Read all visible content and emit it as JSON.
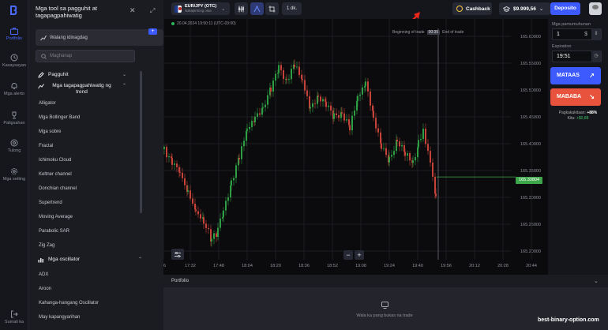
{
  "rail": {
    "items": [
      {
        "label": "Portfolio",
        "icon": "briefcase-icon"
      },
      {
        "label": "Kasaysayan",
        "icon": "history-icon"
      },
      {
        "label": "Mga alerto",
        "icon": "bell-icon"
      },
      {
        "label": "Paligsahan",
        "icon": "trophy-icon"
      },
      {
        "label": "Tulong",
        "icon": "help-icon"
      },
      {
        "label": "Mga setting",
        "icon": "gear-icon"
      },
      {
        "label": "Sumali ka",
        "icon": "logout-icon"
      }
    ]
  },
  "panel": {
    "title": "Mga tool sa pagguhit at tagapagpahiwatig",
    "default_label": "Walang idinagdag",
    "add_badge": "+",
    "search_placeholder": "Maghanap",
    "section_drawing": "Pagguhit",
    "section_indicators": "Mga tagapagpahiwatig ng trend",
    "trend_items": [
      "Alligator",
      "Mga Bollinger Band",
      "Mga sobre",
      "Fractal",
      "Ichimoku Cloud",
      "Keltner channel",
      "Donchian channel",
      "Supertrend",
      "Moving Average",
      "Parabolic SAR",
      "Zig Zag"
    ],
    "section_oscillators": "Mga oscillator",
    "osc_items": [
      "ADX",
      "Aroon",
      "Kahanga-hangang Oscillator",
      "May kapangyarihan"
    ]
  },
  "topbar": {
    "asset_name": "EUR/JPY (OTC)",
    "asset_sub": "Nakapirming oras",
    "period": "1 dk.",
    "cashback": "Cashback",
    "balance": "$9.999,56",
    "deposit": "Deposito"
  },
  "chart": {
    "info_time": "20.04.2024  19:50:11  (UTC-03:00)",
    "beginning_label": "Beginning of trade",
    "beginning_time": "00:35",
    "end_label": "End of trade",
    "current_price": "165.33804",
    "price_ticks": [
      "165.60000",
      "165.55000",
      "165.50000",
      "165.45000",
      "165.40000",
      "165.35000",
      "165.30000",
      "165.25000",
      "165.20000"
    ],
    "time_ticks": [
      "16",
      "17:32",
      "17:48",
      "18:04",
      "18:20",
      "18:36",
      "18:52",
      "19:08",
      "19:24",
      "19:40",
      "19:56",
      "20:12",
      "20:28",
      "20:44"
    ],
    "zoom_out": "−",
    "zoom_in": "+",
    "colors": {
      "up": "#2e9e44",
      "down": "#c6433a",
      "price_line": "#3ea64a"
    }
  },
  "portfolio": {
    "title": "Portfolio",
    "empty_text": "Wala ka pang bukas na trade"
  },
  "trade": {
    "amount_label": "Mga pamumuhunan",
    "amount_value": "1",
    "amount_currency": "$",
    "expiration_label": "Expiration",
    "expiration_value": "19:51",
    "up_label": "MATAAS",
    "down_label": "MABABA",
    "payout_label": "Pagkakakitaan:",
    "payout_pct": "+88%",
    "profit_label": "Kita:",
    "profit_value": "+$0,88"
  },
  "watermark": "best-binary-option.com"
}
